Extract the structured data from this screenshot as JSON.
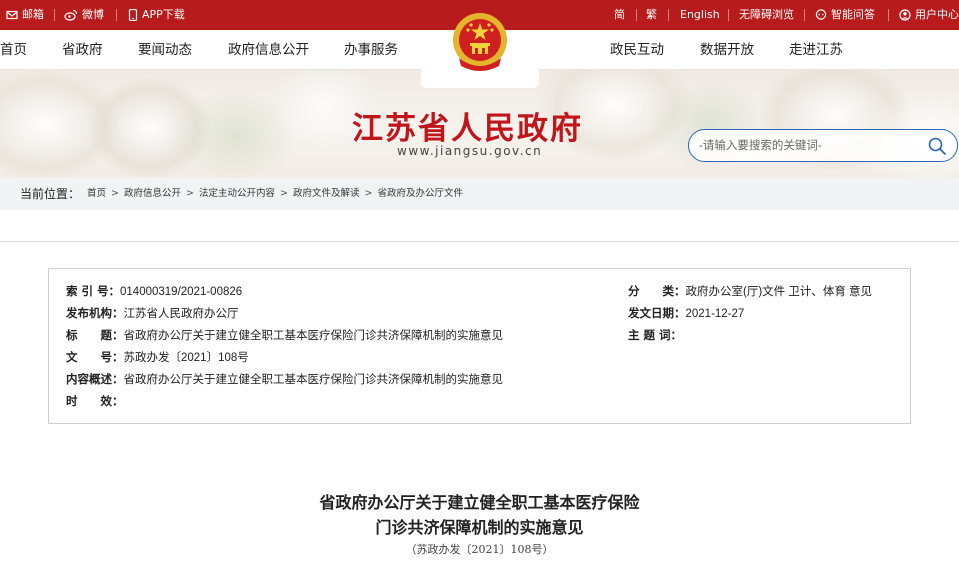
{
  "topbar": {
    "mail": "邮箱",
    "weibo": "微博",
    "app": "APP下载",
    "simplified": "简",
    "traditional": "繁",
    "english": "English",
    "accessibility": "无障碍浏览",
    "qa": "智能问答",
    "user_center": "用户中心"
  },
  "nav": {
    "left": [
      "首页",
      "省政府",
      "要闻动态",
      "政府信息公开",
      "办事服务"
    ],
    "right": [
      "政民互动",
      "数据开放",
      "走进江苏"
    ]
  },
  "site": {
    "title": "江苏省人民政府",
    "url": "www.jiangsu.gov.cn"
  },
  "search": {
    "placeholder": "-请输入要搜索的关键词-"
  },
  "breadcrumb": {
    "label": "当前位置：",
    "items": [
      "首页",
      "政府信息公开",
      "法定主动公开内容",
      "政府文件及解读",
      "省政府及办公厅文件"
    ],
    "separator": ">"
  },
  "meta": {
    "index_no": {
      "key": "索 引 号：",
      "value": "014000319/2021-00826"
    },
    "publisher": {
      "key": "发布机构：",
      "value": "江苏省人民政府办公厅"
    },
    "title": {
      "key": "标　　题：",
      "value": "省政府办公厅关于建立健全职工基本医疗保险门诊共济保障机制的实施意见"
    },
    "doc_no": {
      "key": "文　　号：",
      "value": "苏政办发〔2021〕108号"
    },
    "summary": {
      "key": "内容概述：",
      "value": "省政府办公厅关于建立健全职工基本医疗保险门诊共济保障机制的实施意见"
    },
    "validity": {
      "key": "时　　效：",
      "value": ""
    },
    "category": {
      "key": "分　　类：",
      "value": "政府办公室(厅)文件 卫计、体育 意见"
    },
    "date": {
      "key": "发文日期：",
      "value": "2021-12-27"
    },
    "subject": {
      "key": "主 题 词：",
      "value": ""
    }
  },
  "article": {
    "title_line1": "省政府办公厅关于建立健全职工基本医疗保险",
    "title_line2": "门诊共济保障机制的实施意见",
    "doc_no": "（苏政办发〔2021〕108号）"
  },
  "colors": {
    "brand_red": "#b71b1c",
    "title_red": "#c0151b",
    "search_blue": "#2a66b5"
  }
}
